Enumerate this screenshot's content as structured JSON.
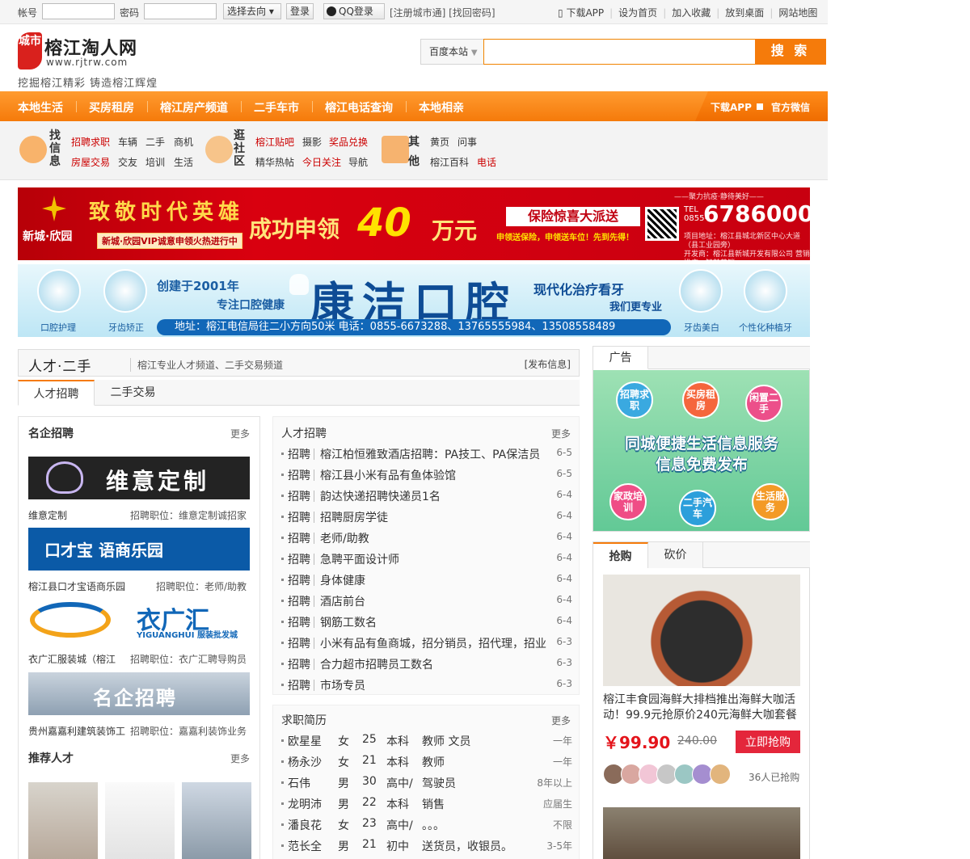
{
  "topbar": {
    "account_label": "帐号",
    "password_label": "密码",
    "select_label": "选择去向",
    "login_label": "登录",
    "qq_login_label": "QQ登录",
    "links": "[注册城市通] [找回密码]",
    "right_links": [
      "下载APP",
      "设为首页",
      "加入收藏",
      "放到桌面",
      "网站地图"
    ]
  },
  "header": {
    "logo_badge": "城市",
    "site_name": "榕江淘人网",
    "site_url": "www.rjtrw.com",
    "slogan": "挖掘榕江精彩 铸造榕江辉煌",
    "search_scope": "百度本站",
    "search_button": "搜 索"
  },
  "nav": {
    "items": [
      "本地生活",
      "买房租房",
      "榕江房产频道",
      "二手车市",
      "榕江电话查询",
      "本地相亲"
    ],
    "download_app": "下载APP",
    "wechat": "官方微信"
  },
  "categories": {
    "group1_title": "找信息",
    "group1_links": [
      "招聘求职",
      "车辆",
      "二手",
      "商机",
      "房屋交易",
      "交友",
      "培训",
      "生活"
    ],
    "group2_title": "逛社区",
    "group2_links": [
      "榕江贴吧",
      "摄影",
      "奖品兑换",
      "精华热帖",
      "今日关注",
      "导航"
    ],
    "group3_title": "其他",
    "group3_links": [
      "黄页",
      "问事",
      "榕江百科",
      "电话"
    ]
  },
  "banner1": {
    "brand": "新城·欣园",
    "headline": "致敬时代英雄",
    "pill": "新城·欣园VIP诚意申领火热进行中",
    "claim_prefix": "成功申领",
    "amount": "40",
    "unit": "万元",
    "insurance": "保险惊喜大派送",
    "insurance_sub": "申领送保险，申领送车位！先到先得！",
    "tagline": "——聚力抗疫·静待美好——",
    "tel_label": "TEL 0855-",
    "tel": "6786000",
    "small1": "项目地址：榕江县城北新区中心大道（县工业园旁）",
    "small2": "开发商：榕江县新城开发有限公司  营销推广：智魅营销"
  },
  "banner2": {
    "since": "创建于2001年",
    "focus": "专注口腔健康",
    "brand": "康洁口腔",
    "modern": "现代化治疗看牙",
    "pro": "我们更专业",
    "address": "地址：榕江电信局往二小方向50米 电话：0855-6673288、13765555984、13508558489",
    "circles": [
      "口腔护理",
      "牙齿矫正",
      "牙齿美白",
      "个性化种植牙"
    ]
  },
  "module": {
    "title": "人才·二手",
    "desc": "榕江专业人才频道、二手交易频道",
    "publish": "[发布信息]",
    "tabs": [
      "人才招聘",
      "二手交易"
    ]
  },
  "left": {
    "corp_title": "名企招聘",
    "more": "更多",
    "corps": [
      {
        "logo_text": "维意定制",
        "name": "维意定制",
        "pos": "招聘职位：维意定制诚招家"
      },
      {
        "logo_text": "口才宝 语商乐园",
        "name": "榕江县口才宝语商乐园",
        "pos": "招聘职位：老师/助教"
      },
      {
        "logo_text": "衣广汇",
        "logo_sub": "YIGUANGHUI 服装批发城",
        "name": "衣广汇服装城（榕江",
        "pos": "招聘职位：衣广汇聘导购员"
      },
      {
        "logo_text": "名企招聘",
        "name": "贵州嘉嘉利建筑装饰工",
        "pos": "招聘职位：嘉嘉利装饰业务"
      }
    ],
    "talent_title": "推荐人才"
  },
  "jobs": {
    "title": "人才招聘",
    "more": "更多",
    "tag": "招聘",
    "rows": [
      {
        "t": "榕江柏恒雅致酒店招聘：PA技工、PA保洁员",
        "d": "6-5"
      },
      {
        "t": "榕江县小米有品有鱼体验馆",
        "d": "6-5"
      },
      {
        "t": "韵达快递招聘快递员1名",
        "d": "6-4"
      },
      {
        "t": "招聘厨房学徒",
        "d": "6-4"
      },
      {
        "t": "老师/助教",
        "d": "6-4"
      },
      {
        "t": "急聘平面设计师",
        "d": "6-4"
      },
      {
        "t": "身体健康",
        "d": "6-4"
      },
      {
        "t": "酒店前台",
        "d": "6-4"
      },
      {
        "t": "钢筋工数名",
        "d": "6-4"
      },
      {
        "t": "小米有品有鱼商城，招分销员，招代理，招业",
        "d": "6-3"
      },
      {
        "t": "合力超市招聘员工数名",
        "d": "6-3"
      },
      {
        "t": "市场专员",
        "d": "6-3"
      }
    ]
  },
  "resumes": {
    "title": "求职简历",
    "more": "更多",
    "rows": [
      {
        "name": "欧星星",
        "sex": "女",
        "age": "25",
        "edu": "本科",
        "job": "教师 文员",
        "exp": "一年"
      },
      {
        "name": "杨永沙",
        "sex": "女",
        "age": "21",
        "edu": "本科",
        "job": "教师",
        "exp": "一年"
      },
      {
        "name": "石伟",
        "sex": "男",
        "age": "30",
        "edu": "高中/",
        "job": "驾驶员",
        "exp": "8年以上"
      },
      {
        "name": "龙明沛",
        "sex": "男",
        "age": "22",
        "edu": "本科",
        "job": "销售",
        "exp": "应届生"
      },
      {
        "name": "潘良花",
        "sex": "女",
        "age": "23",
        "edu": "高中/",
        "job": "。。。",
        "exp": "不限"
      },
      {
        "name": "范长全",
        "sex": "男",
        "age": "21",
        "edu": "初中",
        "job": "送货员，收银员。",
        "exp": "3-5年"
      }
    ]
  },
  "ad": {
    "title": "广告",
    "bubbles": [
      "招聘求职",
      "买房租房",
      "闲置二手",
      "家政培训",
      "二手汽车",
      "生活服务"
    ],
    "headline1": "同城便捷生活信息服务",
    "headline2": "信息免费发布"
  },
  "buy": {
    "tabs": [
      "抢购",
      "砍价"
    ],
    "product": "榕江丰食园海鲜大排档推出海鲜大咖活动！99.9元抢原价240元海鲜大咖套餐",
    "price": "￥99.90",
    "original": "240.00",
    "button": "立即抢购",
    "buyers": "36人已抢购"
  },
  "colors": {
    "accent": "#f57b0b",
    "red": "#e4141b",
    "blue": "#1167b8"
  }
}
